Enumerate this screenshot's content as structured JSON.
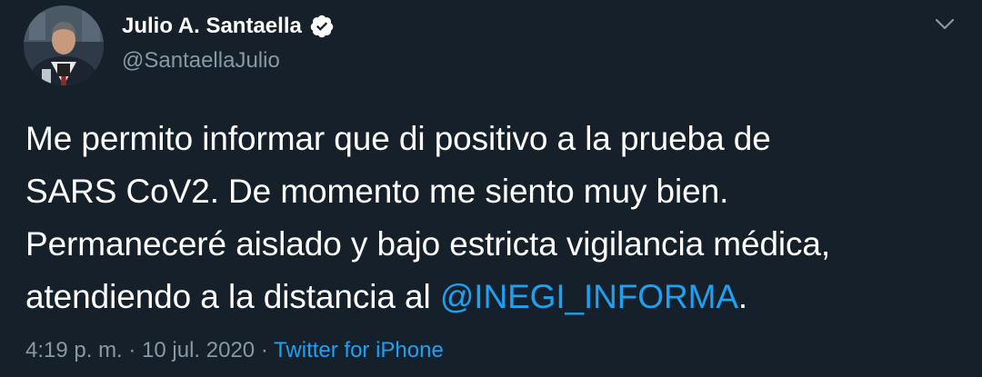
{
  "tweet": {
    "author": {
      "display_name": "Julio A. Santaella",
      "handle": "@SantaellaJulio",
      "verified": true
    },
    "text": {
      "line1": "Me permito informar que di positivo a la prueba de",
      "line2": "SARS CoV2. De momento me siento muy bien.",
      "line3": "Permaneceré aislado y bajo estricta vigilancia médica,",
      "line4_prefix": "atendiendo a la distancia al ",
      "line4_mention": "@INEGI_INFORMA",
      "line4_suffix": "."
    },
    "timestamp": "4:19 p. m. · 10 jul. 2020",
    "separator": " · ",
    "source": "Twitter for iPhone"
  },
  "icons": {
    "verified": "verified-badge-icon",
    "caret": "chevron-down-icon"
  },
  "colors": {
    "background": "#15202b",
    "text": "#ffffff",
    "secondary": "#8899a6",
    "link": "#1da1f2"
  }
}
